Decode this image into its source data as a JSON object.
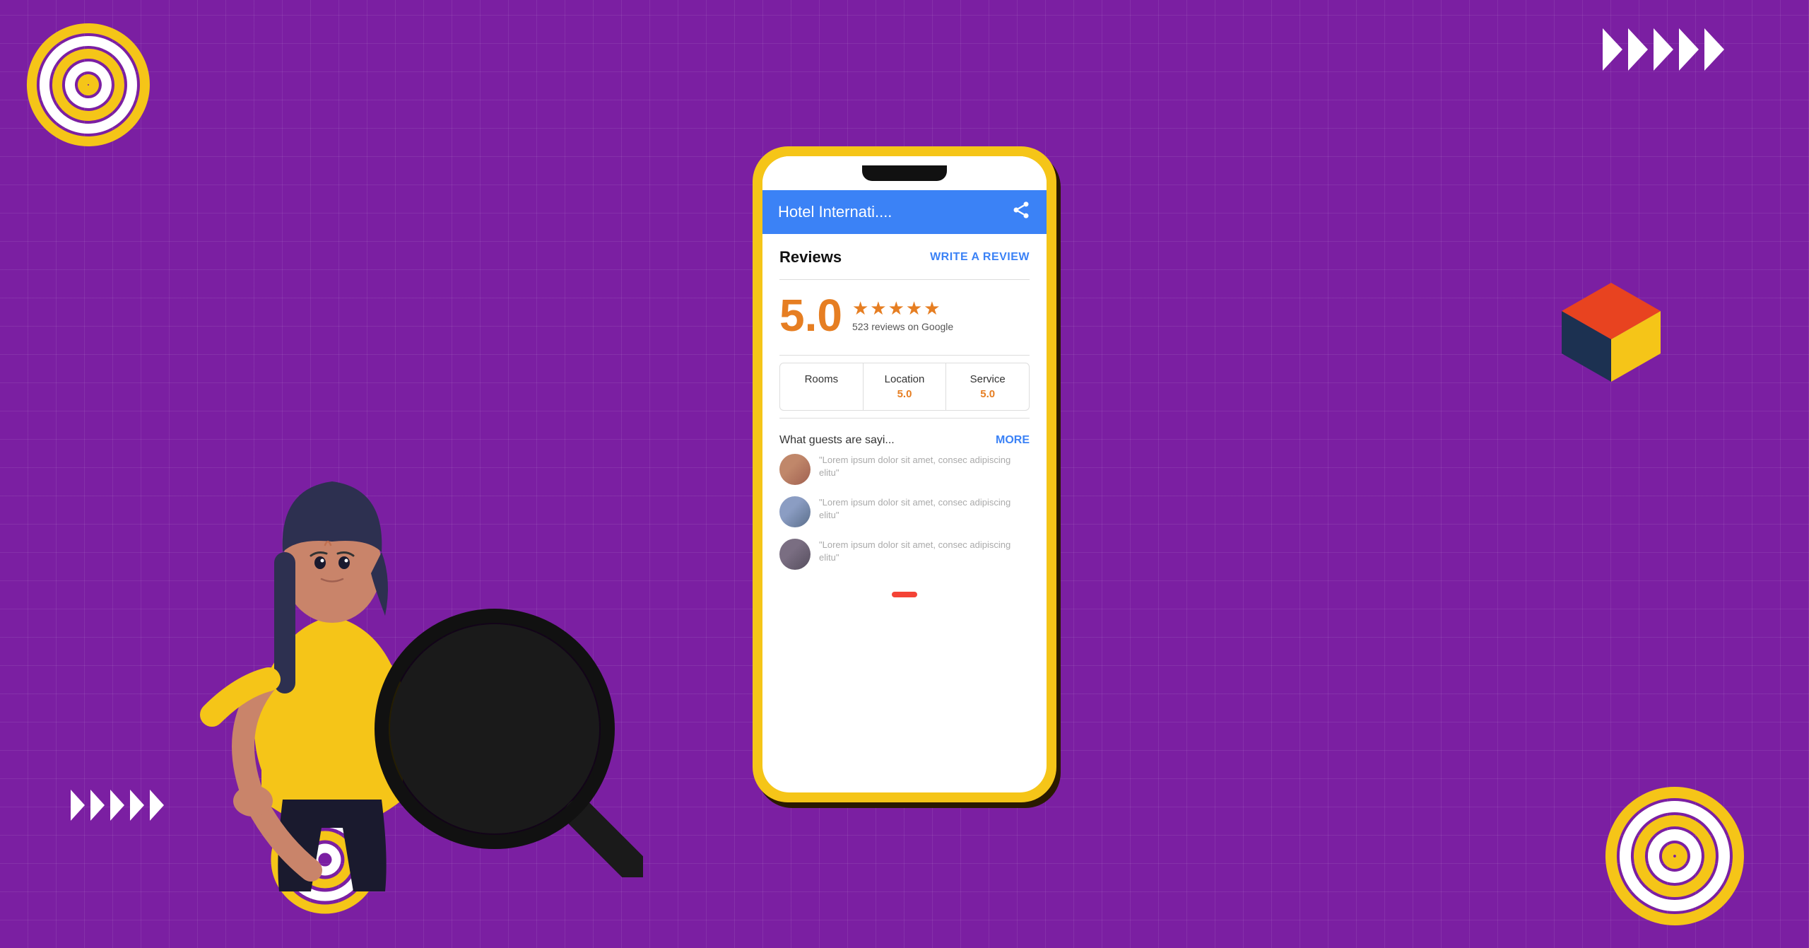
{
  "background": {
    "color": "#7B1FA2"
  },
  "phone": {
    "frame_color": "#F5C518",
    "header": {
      "title": "Hotel Internati....",
      "share_label": "share"
    },
    "reviews": {
      "section_title": "Reviews",
      "write_review_label": "WRITE A REVIEW",
      "overall_rating": "5.0",
      "stars": "★★★★★",
      "review_count": "523 reviews on Google",
      "categories": [
        {
          "name": "Rooms",
          "score": ""
        },
        {
          "name": "Location",
          "score": "5.0"
        },
        {
          "name": "Service",
          "score": "5.0"
        }
      ],
      "guests_section_title": "What guests are sayi...",
      "more_label": "MORE",
      "reviews": [
        {
          "text": "\"Lorem ipsum dolor sit amet, consec adipiscing elitu\""
        },
        {
          "text": "\"Lorem ipsum dolor sit amet, consec adipiscing elitu\""
        },
        {
          "text": "\"Lorem ipsum dolor sit amet, consec adipiscing elitu\""
        }
      ]
    }
  },
  "decorations": {
    "top_left_spiral": "spiral",
    "top_right_chevrons_count": 5,
    "bottom_left_chevrons_count": 5,
    "cube_colors": [
      "#1C3151",
      "#E84320",
      "#F5C518"
    ],
    "bottom_right_spiral": "spiral",
    "bottom_left_spiral2": "spiral"
  }
}
